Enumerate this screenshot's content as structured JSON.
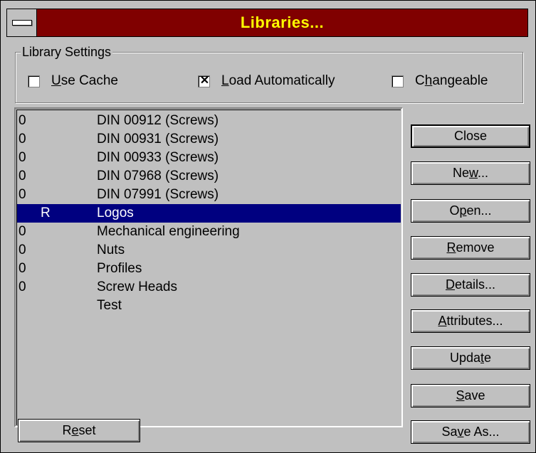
{
  "window": {
    "title": "Libraries..."
  },
  "settings": {
    "group_label": "Library Settings",
    "checkboxes": [
      {
        "label_pre": "",
        "label_u": "U",
        "label_post": "se Cache",
        "checked": false
      },
      {
        "label_pre": "",
        "label_u": "L",
        "label_post": "oad Automatically",
        "checked": true
      },
      {
        "label_pre": "C",
        "label_u": "h",
        "label_post": "angeable",
        "checked": false
      }
    ]
  },
  "libraries": [
    {
      "flag": "0",
      "name": "DIN 00912 (Screws)",
      "selected": false
    },
    {
      "flag": "0",
      "name": "DIN 00931 (Screws)",
      "selected": false
    },
    {
      "flag": "0",
      "name": "DIN 00933 (Screws)",
      "selected": false
    },
    {
      "flag": "0",
      "name": "DIN 07968 (Screws)",
      "selected": false
    },
    {
      "flag": "0",
      "name": "DIN 07991 (Screws)",
      "selected": false
    },
    {
      "flag": "R",
      "name": "Logos",
      "selected": true
    },
    {
      "flag": "0",
      "name": "Mechanical engineering",
      "selected": false
    },
    {
      "flag": "0",
      "name": "Nuts",
      "selected": false
    },
    {
      "flag": "0",
      "name": "Profiles",
      "selected": false
    },
    {
      "flag": "0",
      "name": "Screw Heads",
      "selected": false
    },
    {
      "flag": "",
      "name": "Test",
      "selected": false
    }
  ],
  "buttons": {
    "close": {
      "pre": "Close",
      "u": "",
      "post": ""
    },
    "new": {
      "pre": "Ne",
      "u": "w",
      "post": "..."
    },
    "open": {
      "pre": "O",
      "u": "p",
      "post": "en..."
    },
    "remove": {
      "pre": "",
      "u": "R",
      "post": "emove"
    },
    "details": {
      "pre": "",
      "u": "D",
      "post": "etails..."
    },
    "attributes": {
      "pre": "",
      "u": "A",
      "post": "ttributes..."
    },
    "update": {
      "pre": "Upda",
      "u": "t",
      "post": "e"
    },
    "save": {
      "pre": "",
      "u": "S",
      "post": "ave"
    },
    "save_as": {
      "pre": "Sa",
      "u": "v",
      "post": "e As..."
    },
    "reset": {
      "pre": "R",
      "u": "e",
      "post": "set"
    }
  }
}
